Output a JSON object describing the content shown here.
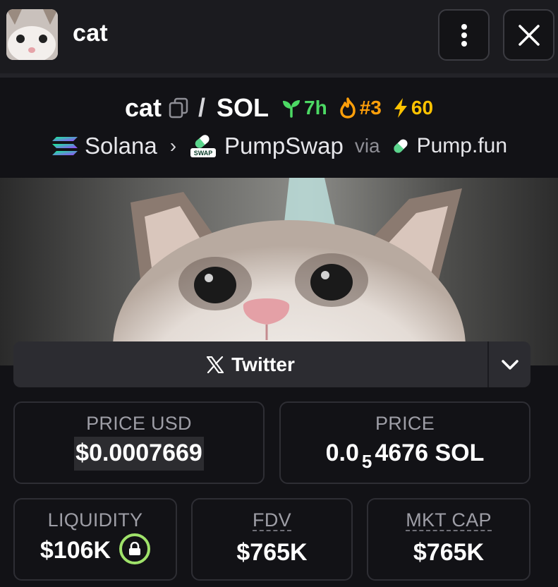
{
  "header": {
    "title": "cat",
    "avatar_icon": "cat-avatar",
    "more_icon": "vertical-dots-icon",
    "close_icon": "close-icon"
  },
  "pair": {
    "base": "cat",
    "separator": "/",
    "quote": "SOL",
    "age": "7h",
    "rank": "#3",
    "boosts": "60",
    "colors": {
      "age": "#4cd964",
      "rank": "#ff9f0a",
      "boosts": "#ffc300"
    }
  },
  "route": {
    "chain": "Solana",
    "dex": "PumpSwap",
    "dex_badge": "SWAP",
    "via": "via",
    "launchpad": "Pump.fun"
  },
  "social": {
    "twitter_label": "Twitter"
  },
  "stats": {
    "price_usd": {
      "label": "PRICE USD",
      "value": "$0.0007669"
    },
    "price": {
      "label": "PRICE",
      "prefix": "0.0",
      "zeros": "5",
      "digits": "4676",
      "unit": "SOL"
    },
    "liquidity": {
      "label": "LIQUIDITY",
      "value": "$106K"
    },
    "fdv": {
      "label": "FDV",
      "value": "$765K"
    },
    "mkt_cap": {
      "label": "MKT CAP",
      "value": "$765K"
    }
  }
}
